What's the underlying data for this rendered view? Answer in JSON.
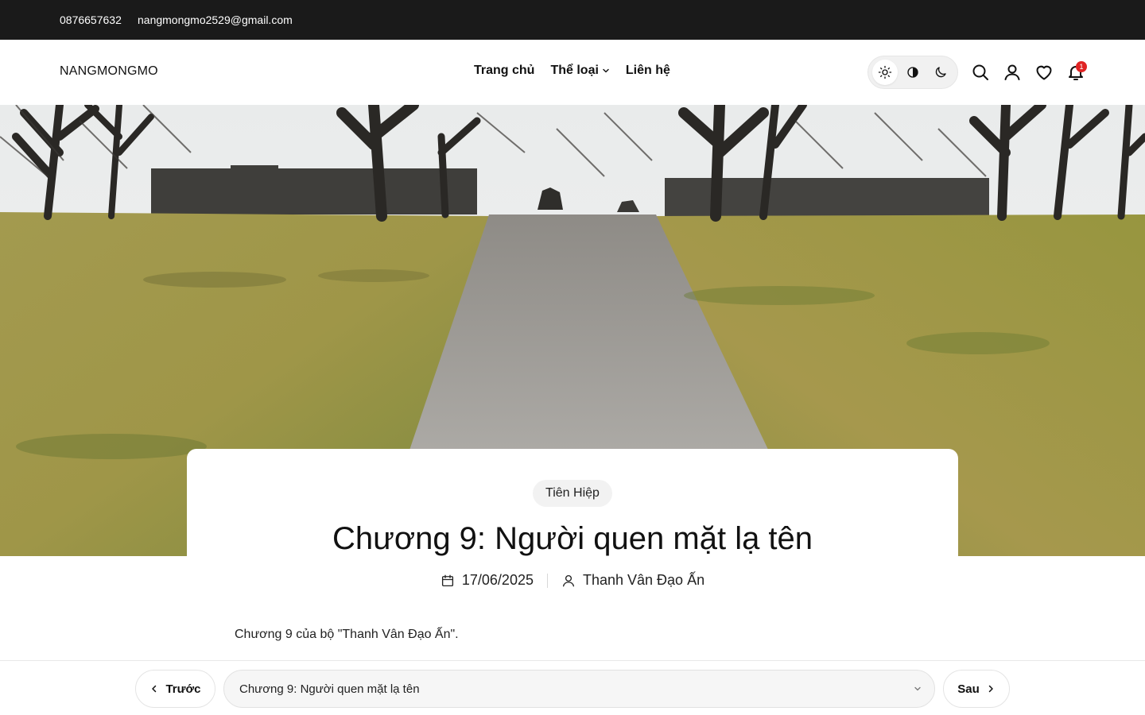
{
  "topbar": {
    "phone": "0876657632",
    "email": "nangmongmo2529@gmail.com"
  },
  "header": {
    "logo": "NANGMONGMO",
    "nav": [
      {
        "label": "Trang chủ"
      },
      {
        "label": "Thể loại",
        "has_dropdown": true
      },
      {
        "label": "Liên hệ"
      }
    ],
    "theme_modes": [
      "light-icon",
      "contrast-icon",
      "moon-icon"
    ],
    "active_theme": "light",
    "icons": [
      "search-icon",
      "user-icon",
      "heart-icon",
      "bell-icon"
    ],
    "notification_count": "1"
  },
  "post": {
    "category": "Tiên Hiệp",
    "title": "Chương 9: Người quen mặt lạ tên",
    "date": "17/06/2025",
    "author": "Thanh Vân Đạo Ấn",
    "intro": "Chương 9 của bộ \"Thanh Vân Đạo Ấn\"."
  },
  "chapter_nav": {
    "prev_label": "Trước",
    "next_label": "Sau",
    "current_chapter": "Chương 9: Người quen mặt lạ tên"
  },
  "colors": {
    "topbar_bg": "#1a1a1a",
    "badge": "#e02424",
    "text": "#111111"
  }
}
